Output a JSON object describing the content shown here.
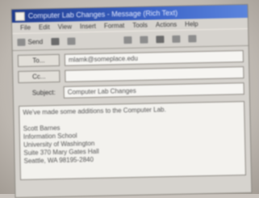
{
  "window": {
    "title": "Computer Lab Changes - Message (Rich Text)"
  },
  "menu": [
    "File",
    "Edit",
    "View",
    "Insert",
    "Format",
    "Tools",
    "Actions",
    "Help"
  ],
  "toolbar": {
    "send_label": "Send"
  },
  "headers": {
    "to_label": "To...",
    "to_value": "mlamk@someplace.edu",
    "cc_label": "Cc...",
    "cc_value": "",
    "subject_label": "Subject:",
    "subject_value": "Computer Lab Changes"
  },
  "body": {
    "lines": [
      "We've made some additions to the Computer Lab.",
      "",
      "Scott Barnes",
      "Information School",
      "University of Washington",
      "Suite 370 Mary Gates Hall",
      "Seattle, WA 98195-2840"
    ]
  }
}
